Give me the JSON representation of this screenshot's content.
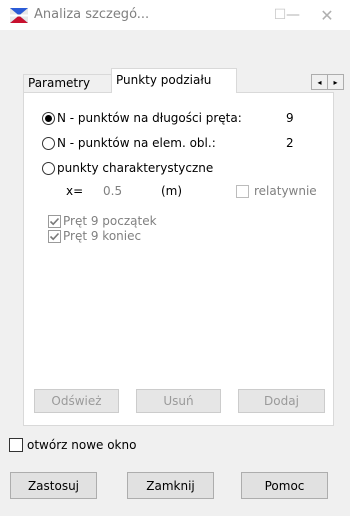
{
  "window": {
    "title": "Analiza szczegó...",
    "minimize_glyph": "—",
    "maximize_glyph": "☐",
    "close_glyph": "✕"
  },
  "tabs": [
    {
      "label": "Parametry",
      "active": false
    },
    {
      "label": "Punkty podziału",
      "active": true
    }
  ],
  "tab_scroll": {
    "left_glyph": "◂",
    "right_glyph": "▸"
  },
  "options": [
    {
      "label": "N - punktów na długości pręta:",
      "value": "9",
      "selected": true
    },
    {
      "label": "N - punktów na elem. obl.:",
      "value": "2",
      "selected": false
    },
    {
      "label": "punkty charakterystyczne",
      "value": "",
      "selected": false
    }
  ],
  "position": {
    "label": "x=",
    "value": "0.5",
    "unit": "(m)",
    "relative_label": "relatywnie",
    "relative_checked": false
  },
  "checks": [
    {
      "label": "Pręt 9 początek",
      "checked": true
    },
    {
      "label": "Pręt 9 koniec",
      "checked": true
    }
  ],
  "panel_buttons": {
    "refresh": "Odśwież",
    "delete": "Usuń",
    "add": "Dodaj"
  },
  "new_window": {
    "label": "otwórz nowe okno",
    "checked": false
  },
  "actions": {
    "apply": "Zastosuj",
    "close": "Zamknij",
    "help": "Pomoc"
  },
  "colors": {
    "disabled_text": "#808080",
    "panel_bg": "#ffffff",
    "dialog_bg": "#f0f0f0"
  }
}
